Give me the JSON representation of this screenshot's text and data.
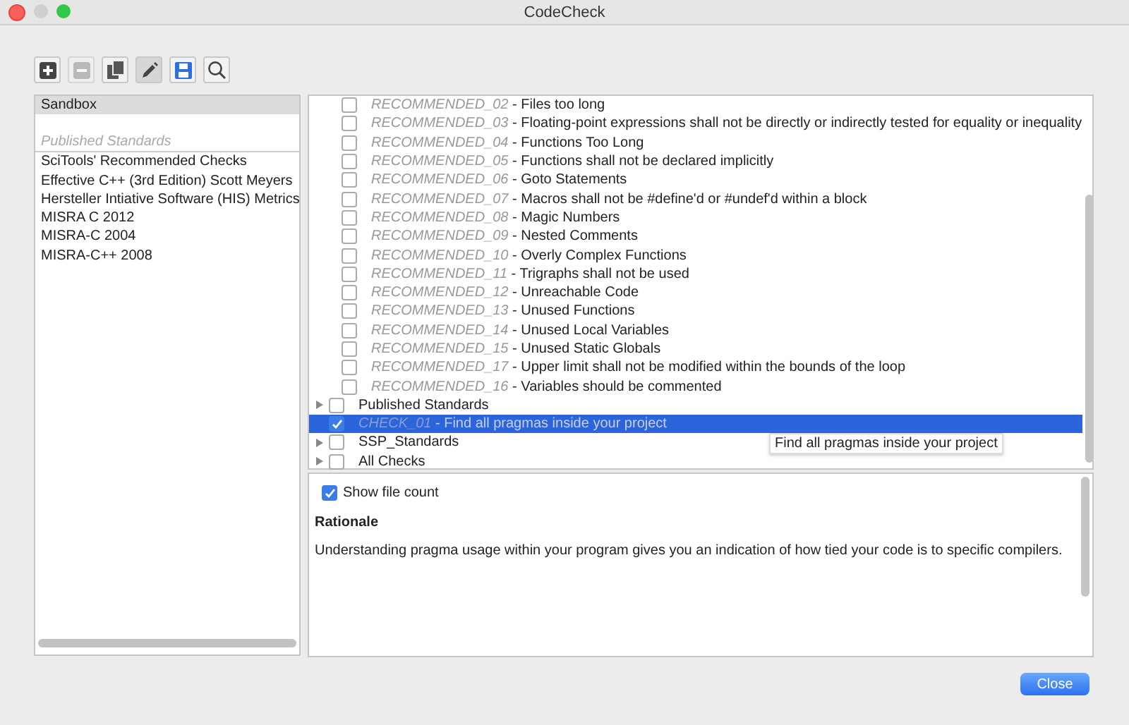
{
  "window": {
    "title": "CodeCheck"
  },
  "toolbar": [
    {
      "kind": "add",
      "disabled": false,
      "pressed": false
    },
    {
      "kind": "remove",
      "disabled": true,
      "pressed": false
    },
    {
      "kind": "copy",
      "disabled": false,
      "pressed": false
    },
    {
      "kind": "edit",
      "disabled": false,
      "pressed": true
    },
    {
      "kind": "save",
      "disabled": false,
      "pressed": false
    },
    {
      "kind": "search",
      "disabled": false,
      "pressed": false
    }
  ],
  "sidebar": {
    "items": [
      {
        "kind": "item",
        "label": "Sandbox",
        "selected": true
      },
      {
        "kind": "spacer"
      },
      {
        "kind": "header",
        "label": "Published Standards"
      },
      {
        "kind": "item",
        "label": "SciTools' Recommended Checks",
        "selected": false
      },
      {
        "kind": "item",
        "label": "Effective C++ (3rd Edition) Scott Meyers",
        "selected": false
      },
      {
        "kind": "item",
        "label": "Hersteller Intiative Software (HIS) Metrics",
        "selected": false
      },
      {
        "kind": "item",
        "label": "MISRA C 2012",
        "selected": false
      },
      {
        "kind": "item",
        "label": "MISRA-C 2004",
        "selected": false
      },
      {
        "kind": "item",
        "label": "MISRA-C++ 2008",
        "selected": false
      }
    ]
  },
  "tree": [
    {
      "kind": "continued",
      "children": [
        {
          "kind": "check",
          "label": "*RECOMMENDED_02* - Files too long",
          "checked": false,
          "selected": false
        },
        {
          "kind": "check",
          "label": "*RECOMMENDED_03* - Floating-point expressions shall not be directly or indirectly tested for equality or inequality",
          "checked": false,
          "selected": false
        },
        {
          "kind": "check",
          "label": "*RECOMMENDED_04* - Functions Too Long",
          "checked": false,
          "selected": false
        },
        {
          "kind": "check",
          "label": "*RECOMMENDED_05* - Functions shall not be declared implicitly",
          "checked": false,
          "selected": false
        },
        {
          "kind": "check",
          "label": "*RECOMMENDED_06* - Goto Statements",
          "checked": false,
          "selected": false
        },
        {
          "kind": "check",
          "label": "*RECOMMENDED_07* - Macros shall not be #define'd or #undef'd within a block",
          "checked": false,
          "selected": false
        },
        {
          "kind": "check",
          "label": "*RECOMMENDED_08* - Magic Numbers",
          "checked": false,
          "selected": false
        },
        {
          "kind": "check",
          "label": "*RECOMMENDED_09* - Nested Comments",
          "checked": false,
          "selected": false
        },
        {
          "kind": "check",
          "label": "*RECOMMENDED_10* - Overly Complex Functions",
          "checked": false,
          "selected": false
        },
        {
          "kind": "check",
          "label": "*RECOMMENDED_11* - Trigraphs shall not be used",
          "checked": false,
          "selected": false
        },
        {
          "kind": "check",
          "label": "*RECOMMENDED_12* - Unreachable Code",
          "checked": false,
          "selected": false
        },
        {
          "kind": "check",
          "label": "*RECOMMENDED_13* - Unused Functions",
          "checked": false,
          "selected": false
        },
        {
          "kind": "check",
          "label": "*RECOMMENDED_14* - Unused Local Variables",
          "checked": false,
          "selected": false
        },
        {
          "kind": "check",
          "label": "*RECOMMENDED_15* - Unused Static Globals",
          "checked": false,
          "selected": false
        },
        {
          "kind": "check",
          "label": "*RECOMMENDED_17* - Upper limit shall not be modified within the bounds of the loop",
          "checked": false,
          "selected": false
        },
        {
          "kind": "check",
          "label": "*RECOMMENDED_16* - Variables should be commented",
          "checked": false,
          "selected": false
        }
      ]
    },
    {
      "kind": "group",
      "label": "Published Standards",
      "checked": false,
      "expanded": false
    },
    {
      "kind": "check",
      "label": "*CHECK_01* - Find all pragmas inside your project",
      "checked": true,
      "selected": true
    },
    {
      "kind": "group",
      "label": "SSP_Standards",
      "checked": false,
      "expanded": false
    },
    {
      "kind": "group",
      "label": "All Checks",
      "checked": false,
      "expanded": false
    }
  ],
  "tooltip": "Find all pragmas inside your project",
  "details": {
    "show_file_count": {
      "label": "Show file count",
      "checked": true
    },
    "heading": "Rationale",
    "text": "Understanding pragma usage within your program gives you an indication of how tied your code is to specific compilers."
  },
  "buttons": [
    "Close"
  ]
}
